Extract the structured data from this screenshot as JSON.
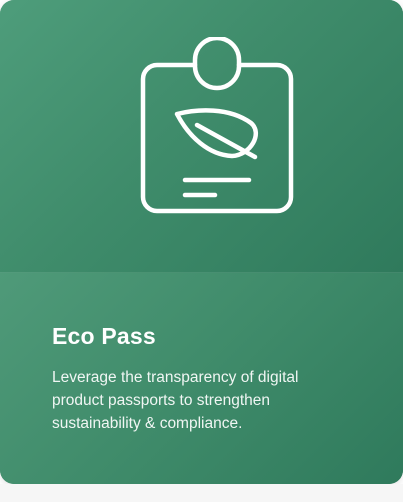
{
  "card": {
    "icon": "badge-leaf-icon",
    "title": "Eco Pass",
    "description": "Leverage the transparency of digital\nproduct passports to strengthen\nsustainability & compliance.",
    "colors": {
      "accent": "#3f8b6a",
      "text": "#ffffff"
    }
  }
}
